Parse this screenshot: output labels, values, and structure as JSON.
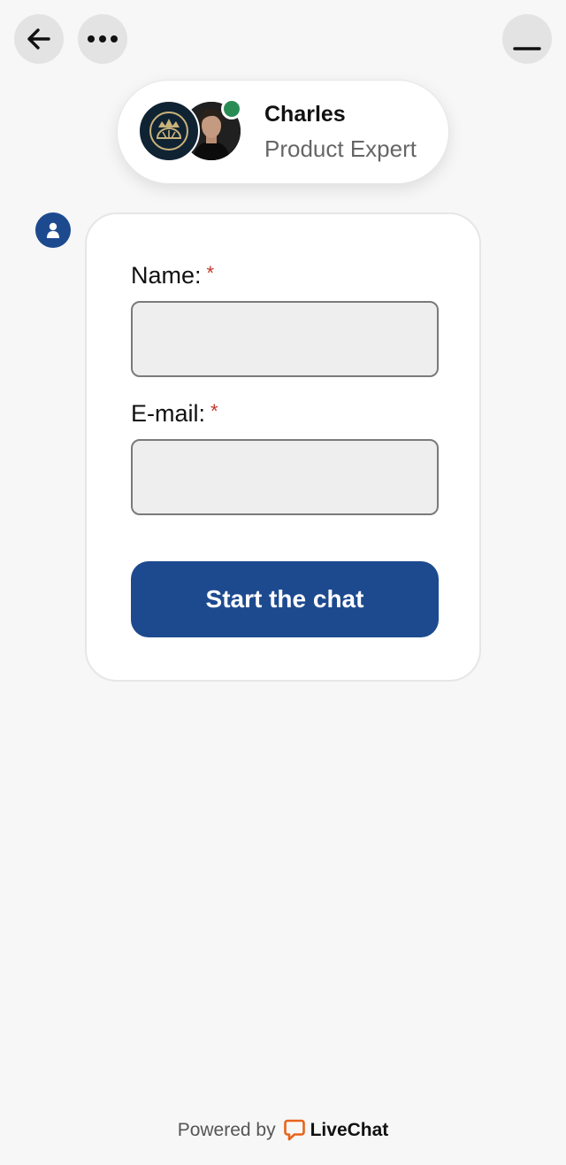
{
  "colors": {
    "accent": "#1d4a8f",
    "online": "#2a8c55",
    "required": "#c0392b",
    "brand": "#e8641b"
  },
  "header": {
    "back_icon": "arrow-left-icon",
    "more_icon": "more-horizontal-icon",
    "minimize_icon": "minimize-icon"
  },
  "agent": {
    "name": "Charles",
    "role": "Product Expert",
    "status": "online"
  },
  "form": {
    "name_label": "Name:",
    "email_label": "E-mail:",
    "required_mark": "*",
    "name_value": "",
    "email_value": "",
    "submit_label": "Start the chat"
  },
  "footer": {
    "powered_by": "Powered by",
    "brand": "LiveChat"
  }
}
